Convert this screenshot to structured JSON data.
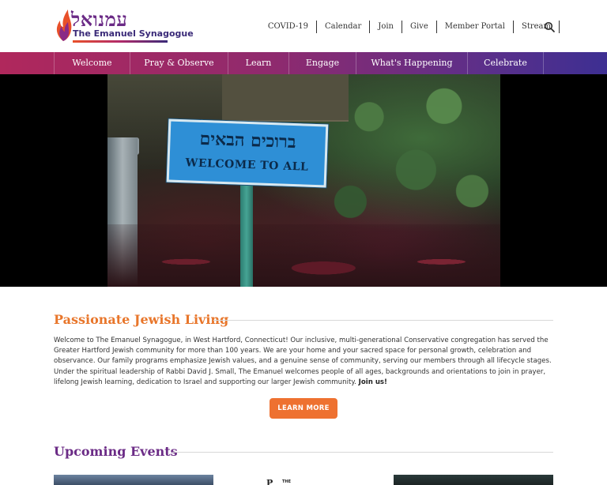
{
  "brand": {
    "hebrew_name": "עמנואל",
    "name": "The Emanuel Synagogue",
    "colors": {
      "purple": "#6b2b86",
      "orange": "#e8762b",
      "navy": "#3a2a78",
      "button": "#ee7130"
    }
  },
  "topnav": {
    "items": [
      {
        "label": "COVID-19"
      },
      {
        "label": "Calendar"
      },
      {
        "label": "Join"
      },
      {
        "label": "Give"
      },
      {
        "label": "Member Portal"
      },
      {
        "label": "Stream"
      }
    ],
    "search_icon": "search-icon"
  },
  "mainnav": {
    "items": [
      {
        "label": "Welcome"
      },
      {
        "label": "Pray & Observe"
      },
      {
        "label": "Learn"
      },
      {
        "label": "Engage"
      },
      {
        "label": "What's Happening"
      },
      {
        "label": "Celebrate"
      }
    ]
  },
  "hero": {
    "sign_hebrew": "ברוכים הבאים",
    "sign_english": "WELCOME TO ALL"
  },
  "about": {
    "heading": "Passionate Jewish Living",
    "body": "Welcome to The Emanuel Synagogue, in West Hartford, Connecticut! Our inclusive, multi-generational Conservative congregation has served the Greater Hartford Jewish community for more than 100 years. We are your home and your sacred space for personal growth, celebration and observance. Our family programs emphasize Jewish values, and a genuine sense of community, serving our members through all lifecycle stages. Under the spiritual leadership of Rabbi David J. Small, The Emanuel welcomes people of all ages, backgrounds and orientations to join in prayer, lifelong Jewish learning, dedication to Israel and supporting our larger Jewish community.",
    "join_link": "Join us!",
    "button_label": "LEARN MORE"
  },
  "events": {
    "heading": "Upcoming Events",
    "card2_letter": "P",
    "card2_small": "THE"
  }
}
